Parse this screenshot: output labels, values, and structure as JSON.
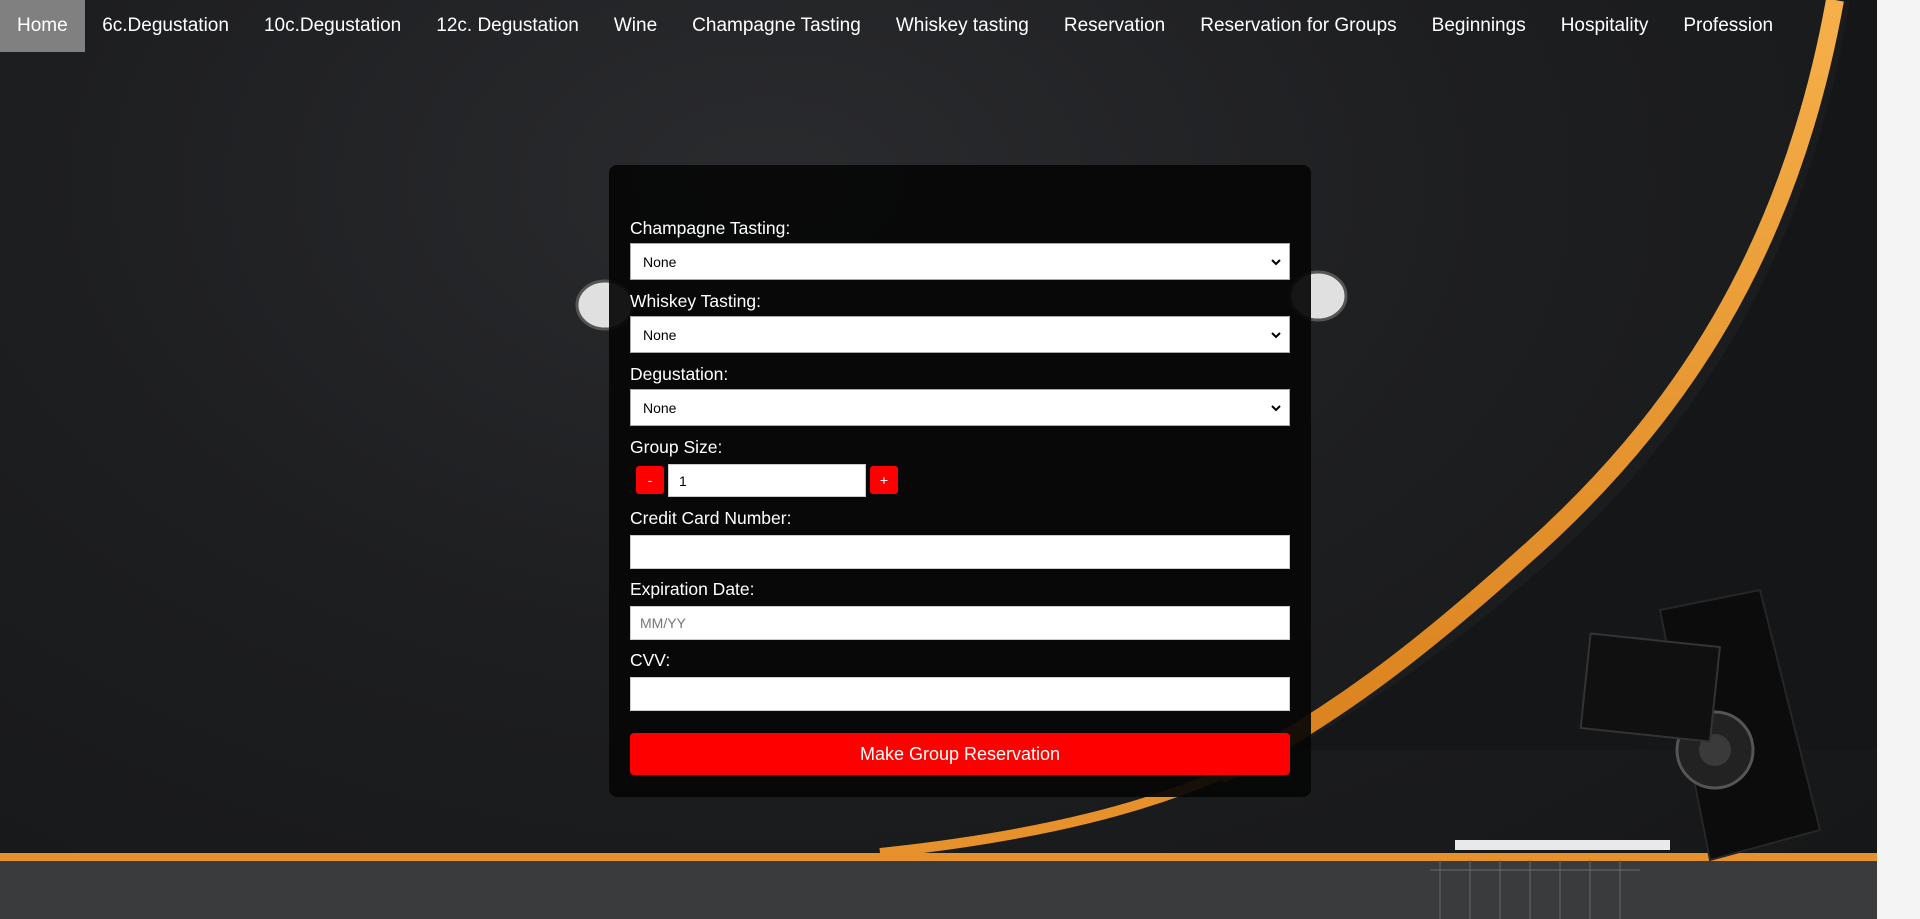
{
  "nav": {
    "items": [
      {
        "label": "Home",
        "active": true
      },
      {
        "label": "6c.Degustation"
      },
      {
        "label": "10c.Degustation"
      },
      {
        "label": "12c. Degustation"
      },
      {
        "label": "Wine"
      },
      {
        "label": "Champagne Tasting"
      },
      {
        "label": "Whiskey tasting"
      },
      {
        "label": "Reservation"
      },
      {
        "label": "Reservation for Groups"
      },
      {
        "label": "Beginnings"
      },
      {
        "label": "Hospitality"
      },
      {
        "label": "Profession"
      }
    ]
  },
  "form": {
    "champagne": {
      "label": "Champagne Tasting:",
      "value": "None"
    },
    "whiskey": {
      "label": "Whiskey Tasting:",
      "value": "None"
    },
    "degustation": {
      "label": "Degustation:",
      "value": "None"
    },
    "group_size": {
      "label": "Group Size:",
      "value": "1",
      "decrement": "-",
      "increment": "+"
    },
    "card_number": {
      "label": "Credit Card Number:",
      "value": ""
    },
    "expiration": {
      "label": "Expiration Date:",
      "placeholder": "MM/YY"
    },
    "cvv": {
      "label": "CVV:",
      "value": ""
    },
    "submit_label": "Make Group Reservation"
  },
  "colors": {
    "accent": "#ff0000",
    "nav_active": "#808080",
    "panel": "#060606",
    "background_light": "#f0a030"
  },
  "icons": {
    "select_arrow": "chevron-down-icon"
  }
}
